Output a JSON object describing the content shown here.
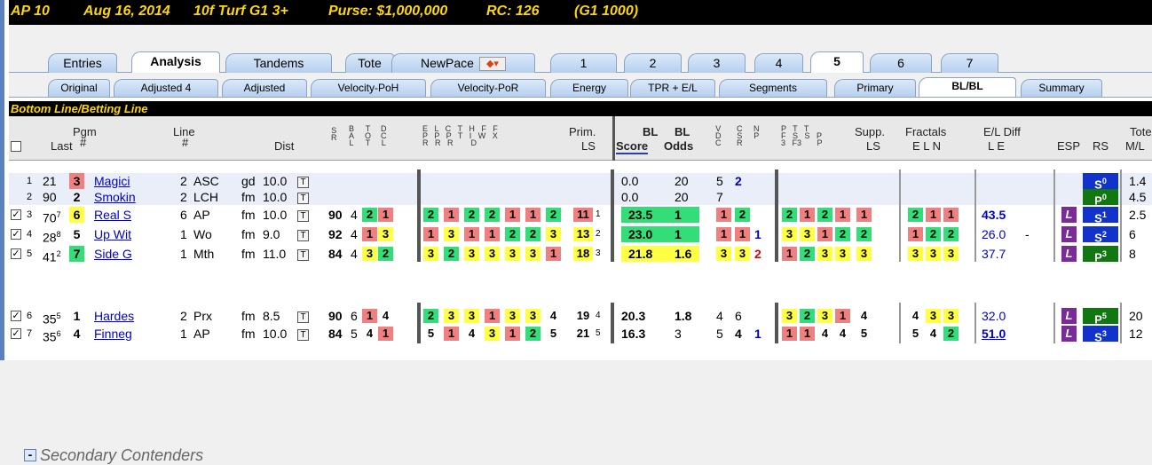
{
  "title": {
    "track": "AP 10",
    "date": "Aug 16, 2014",
    "race": "10f Turf G1 3+",
    "purse": "Purse: $1,000,000",
    "rc": "RC: 126",
    "grade": "(G1 1000)"
  },
  "tabs_top": [
    "Entries",
    "Analysis",
    "Tandems",
    "Tote",
    "NewPace",
    "1",
    "2",
    "3",
    "4",
    "5",
    "6",
    "7"
  ],
  "tabs_sub": [
    "Original",
    "Adjusted 4",
    "Adjusted",
    "Velocity-PoH",
    "Velocity-PoR",
    "Energy",
    "TPR + E/L",
    "Segments",
    "Primary",
    "BL/BL",
    "Summary"
  ],
  "section_title": "Bottom Line/Betting Line",
  "headers": {
    "pgm": "Pgm",
    "pgm2": "#",
    "last": "Last",
    "line": "Line",
    "line2": "#",
    "dist": "Dist",
    "s_r": "S\nR",
    "b_a_l": "B\nA\nL",
    "t_o_t": "T\nO\nT",
    "d_c_l": "D\nC\nL",
    "elc": "E   L   C   T   H   F   F\nP   P   P   T   I   W   X\nR   R   R        D",
    "prim": "Prim.",
    "ls": "LS",
    "bl_score": "BL",
    "bl_score2": "Score",
    "bl_odds": "BL",
    "bl_odds2": "Odds",
    "vdc": "V\nD\nC",
    "csr": "C\nS\nR",
    "np": "N\nP",
    "pft": "P   T   T\nF   S   S   P\n3   F3       P",
    "supp": "Supp.",
    "supp2": "LS",
    "fractals": "Fractals",
    "eln": "E  L  N",
    "el_diff": "E/L Diff",
    "el2": "L    E",
    "esp": "ESP",
    "rs": "RS",
    "tote": "Tote",
    "ml": "M/L"
  },
  "rows": [
    {
      "n": "1",
      "last": "21",
      "pgm": "3",
      "name": "Magici",
      "line": "2",
      "trk": "ASC",
      "cond": "gd",
      "dist": "10.0",
      "bl": "0.0",
      "odds": "20",
      "v": "5",
      "c": "2",
      "rs": "S",
      "rsn": "0",
      "ml": "1.4"
    },
    {
      "n": "2",
      "last": "90",
      "pgm": "2",
      "name": "Smokin",
      "line": "2",
      "trk": "LCH",
      "cond": "fm",
      "dist": "10.0",
      "bl": "0.0",
      "odds": "20",
      "v": "7",
      "c": "",
      "rs": "P",
      "rsn": "0",
      "ml": "4.5"
    },
    {
      "n": "3",
      "last": "70",
      "sup": "7",
      "pgm": "6",
      "name": "Real S",
      "line": "6",
      "trk": "AP",
      "cond": "fm",
      "dist": "10.0",
      "sr": "90",
      "bal": "4",
      "t": "2",
      "d": "1",
      "f": [
        "2",
        "1",
        "2",
        "2",
        "1",
        "1",
        "2"
      ],
      "prim": "11",
      "pr2": "1",
      "bl": "23.5",
      "odds": "1",
      "v": "1",
      "c": "2",
      "n2": "",
      "pf": [
        "2",
        "1",
        "2",
        "1"
      ],
      "supp": "1",
      "fr": [
        "2",
        "1",
        "1"
      ],
      "l": "43.5",
      "e": "",
      "rs": "S",
      "rsn": "1",
      "ml": "2.5"
    },
    {
      "n": "4",
      "last": "28",
      "sup": "8",
      "pgm": "5",
      "name": "Up Wit",
      "line": "1",
      "trk": "Wo",
      "cond": "fm",
      "dist": "9.0",
      "sr": "92",
      "bal": "4",
      "t": "1",
      "d": "3",
      "f": [
        "1",
        "3",
        "1",
        "1",
        "2",
        "2",
        "3"
      ],
      "prim": "13",
      "pr2": "2",
      "bl": "23.0",
      "odds": "1",
      "v": "1",
      "c": "1",
      "n2": "1",
      "pf": [
        "3",
        "3",
        "1",
        "2"
      ],
      "supp": "2",
      "fr": [
        "1",
        "2",
        "2"
      ],
      "l": "26.0",
      "e": "-",
      "rs": "S",
      "rsn": "2",
      "ml": "6"
    },
    {
      "n": "5",
      "last": "41",
      "sup": "2",
      "pgm": "7",
      "name": "Side G",
      "line": "1",
      "trk": "Mth",
      "cond": "fm",
      "dist": "11.0",
      "sr": "84",
      "bal": "4",
      "t": "3",
      "d": "2",
      "f": [
        "3",
        "2",
        "3",
        "3",
        "3",
        "3",
        "1"
      ],
      "prim": "18",
      "pr2": "3",
      "bl": "21.8",
      "odds": "1.6",
      "v": "3",
      "c": "3",
      "n2": "2",
      "pf": [
        "1",
        "2",
        "3",
        "3"
      ],
      "supp": "3",
      "fr": [
        "3",
        "3",
        "3"
      ],
      "l": "37.7",
      "e": "",
      "rs": "P",
      "rsn": "3",
      "ml": "8"
    },
    {
      "n": "6",
      "last": "35",
      "sup": "5",
      "pgm": "1",
      "name": "Hardes",
      "line": "2",
      "trk": "Prx",
      "cond": "fm",
      "dist": "8.5",
      "sr": "90",
      "bal": "6",
      "t": "1",
      "d": "4",
      "f": [
        "2",
        "3",
        "3",
        "1",
        "3",
        "3",
        "4"
      ],
      "prim": "19",
      "pr2": "4",
      "bl": "20.3",
      "odds": "1.8",
      "v": "4",
      "c": "6",
      "n2": "",
      "pf": [
        "3",
        "2",
        "3",
        "1"
      ],
      "supp": "4",
      "fr": [
        "4",
        "3",
        "3"
      ],
      "l": "32.0",
      "e": "",
      "rs": "P",
      "rsn": "5",
      "ml": "20"
    },
    {
      "n": "7",
      "last": "35",
      "sup": "6",
      "pgm": "4",
      "name": "Finneg",
      "line": "1",
      "trk": "AP",
      "cond": "fm",
      "dist": "10.0",
      "sr": "84",
      "bal": "5",
      "t": "4",
      "d": "1",
      "f": [
        "5",
        "1",
        "4",
        "3",
        "1",
        "2",
        "5"
      ],
      "prim": "21",
      "pr2": "5",
      "bl": "16.3",
      "odds": "3",
      "v": "5",
      "c": "4",
      "n2": "1",
      "pf": [
        "1",
        "1",
        "4",
        "4"
      ],
      "supp": "5",
      "fr": [
        "5",
        "4",
        "2"
      ],
      "l": "51.0",
      "e": "",
      "rs": "S",
      "rsn": "3",
      "ml": "12"
    }
  ],
  "secondary": "Secondary Contenders",
  "esp_label": "L",
  "tbox": "T",
  "colors": {
    "yellow": "#ffff44",
    "green": "#33dd77",
    "red": "#f08080",
    "purple": "#7b2a9a",
    "blue": "#0000cc"
  }
}
